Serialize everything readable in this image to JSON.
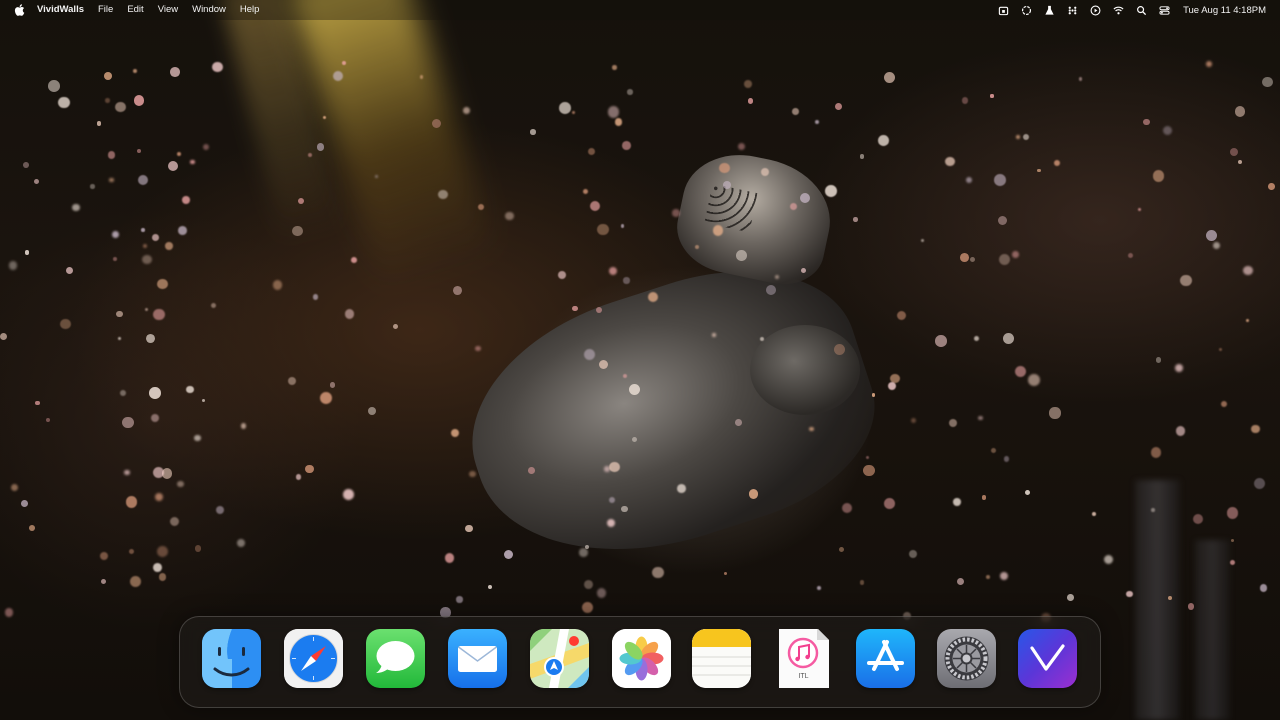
{
  "menubar": {
    "apple_icon": "apple-logo-icon",
    "app_name": "VividWalls",
    "menus": [
      "File",
      "Edit",
      "View",
      "Window",
      "Help"
    ],
    "status_icons": [
      "calendar-lock-icon",
      "chatgpt-icon",
      "flask-icon",
      "grid-dots-icon",
      "play-circle-icon",
      "wifi-icon",
      "search-icon",
      "control-center-icon"
    ],
    "clock": "Tue Aug 11  4:18PM"
  },
  "dock": {
    "apps": [
      {
        "name": "Finder",
        "icon": "finder-icon"
      },
      {
        "name": "Safari",
        "icon": "safari-compass-icon"
      },
      {
        "name": "Messages",
        "icon": "messages-bubble-icon"
      },
      {
        "name": "Mail",
        "icon": "mail-envelope-icon"
      },
      {
        "name": "Maps",
        "icon": "maps-icon"
      },
      {
        "name": "Photos",
        "icon": "photos-flower-icon"
      },
      {
        "name": "Notes",
        "icon": "notes-icon"
      },
      {
        "name": "ITL",
        "icon": "music-file-icon",
        "label": "ITL"
      },
      {
        "name": "App Store",
        "icon": "app-store-icon"
      },
      {
        "name": "System Settings",
        "icon": "gear-icon"
      },
      {
        "name": "VividWalls",
        "icon": "vividwalls-v-icon"
      }
    ]
  },
  "colors": {
    "finder_blue": "#1e88f0",
    "messages_green": "#34c759",
    "mail_blue": "#1a8cf5",
    "appstore_blue": "#1b8cf2",
    "vividwalls_purple": "#5d3bd8",
    "notes_yellow": "#f7c51e"
  }
}
